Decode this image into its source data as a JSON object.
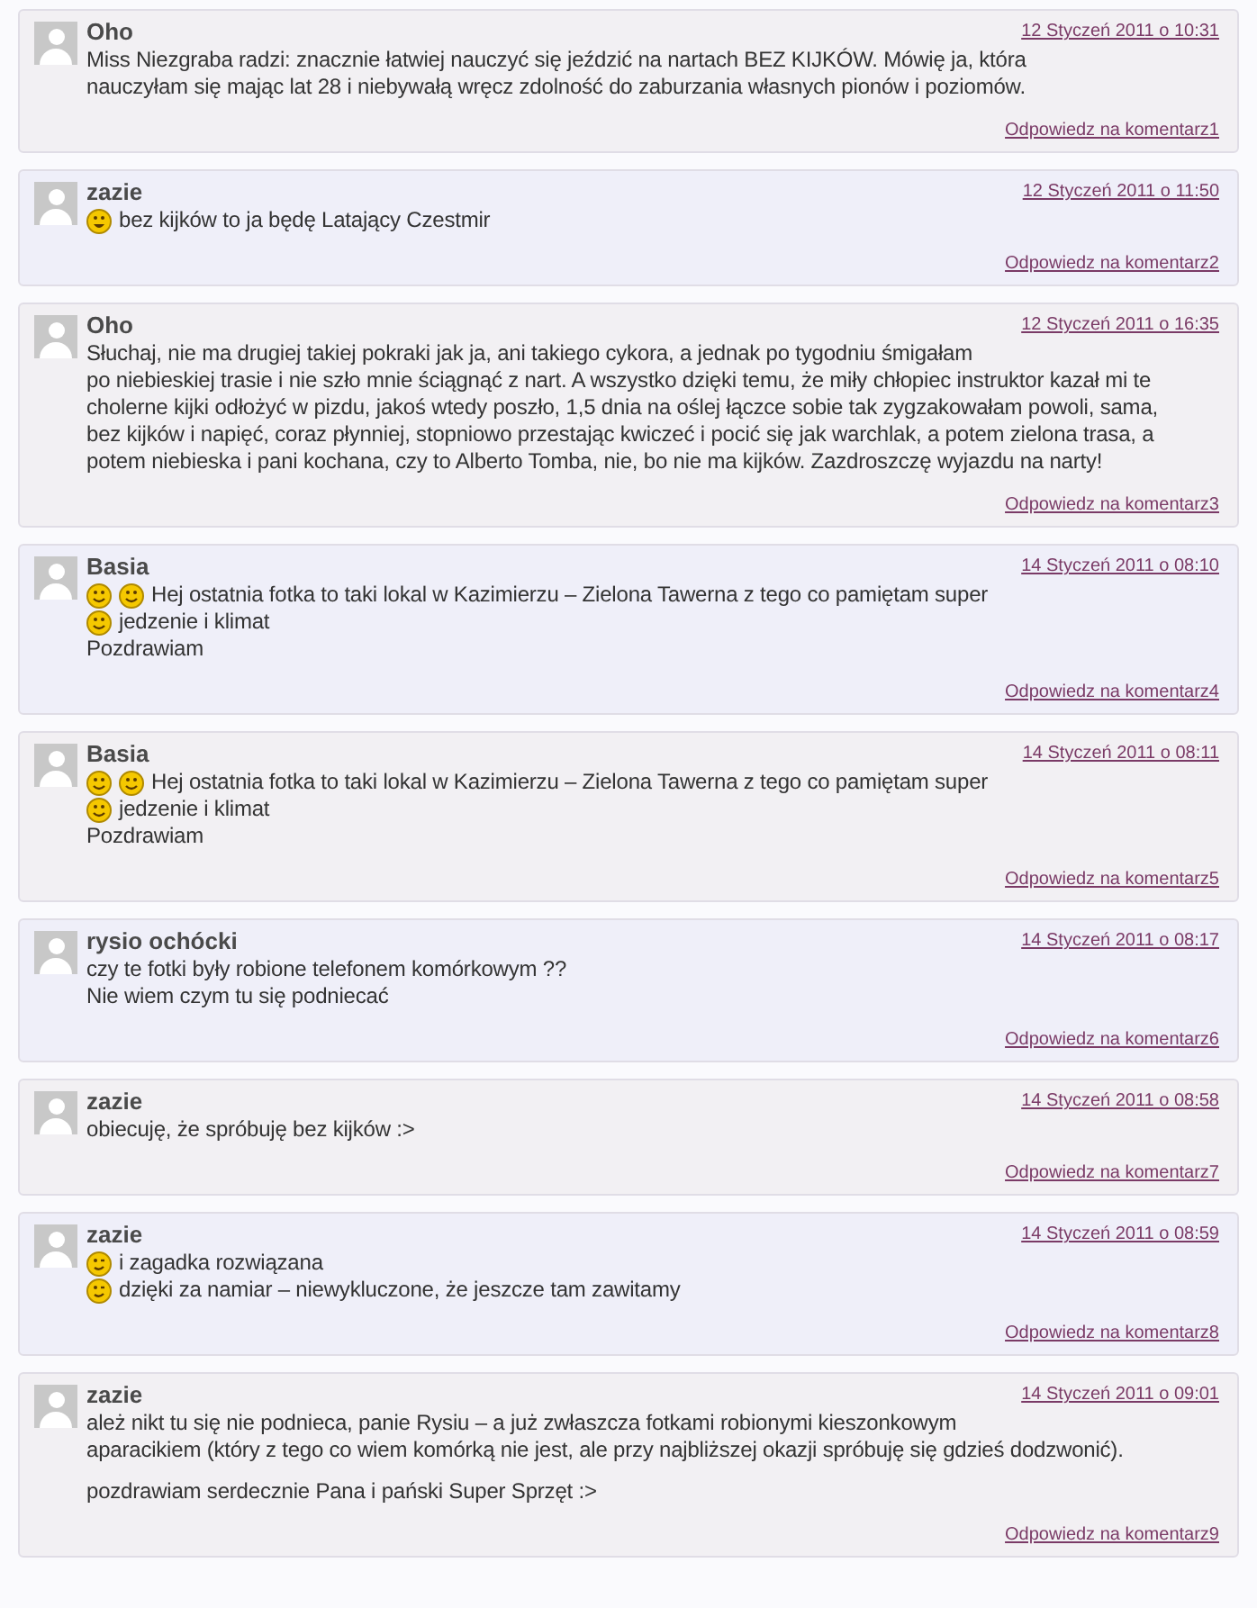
{
  "comments": [
    {
      "author": "Oho",
      "date": "12 Styczeń 2011 o 10:31",
      "reply": "Odpowiedz na komentarz1",
      "paragraphs": [
        [
          {
            "text": "Miss Niezgraba radzi: znacznie łatwiej nauczyć się jeździć na nartach BEZ KIJKÓW. Mówię ja, która"
          },
          {
            "text": "nauczyłam się mając lat 28 i niebywałą wręcz zdolność do zaburzania własnych pionów i poziomów."
          }
        ]
      ]
    },
    {
      "author": "zazie",
      "date": "12 Styczeń 2011 o 11:50",
      "reply": "Odpowiedz na komentarz2",
      "paragraphs": [
        [
          {
            "emoticons": [
              {
                "kind": "grin"
              }
            ],
            "text": "bez kijków to ja będę Latający Czestmir"
          }
        ]
      ]
    },
    {
      "author": "Oho",
      "date": "12 Styczeń 2011 o 16:35",
      "reply": "Odpowiedz na komentarz3",
      "paragraphs": [
        [
          {
            "text": "Słuchaj, nie ma drugiej takiej pokraki jak ja, ani takiego cykora, a jednak po tygodniu śmigałam"
          },
          {
            "text": "po niebieskiej trasie i nie szło mnie ściągnąć z nart. A wszystko dzięki temu, że miły chłopiec instruktor kazał mi te"
          },
          {
            "text": "cholerne kijki odłożyć w pizdu, jakoś wtedy poszło, 1,5 dnia na oślej łączce sobie tak zygzakowałam powoli, sama,"
          },
          {
            "text": "bez kijków i napięć, coraz płynniej, stopniowo przestając kwiczeć i pocić się jak warchlak, a potem zielona trasa, a"
          },
          {
            "text": "potem niebieska i pani kochana, czy to Alberto Tomba, nie, bo nie ma kijków. Zazdroszczę wyjazdu na narty!"
          }
        ]
      ]
    },
    {
      "author": "Basia",
      "date": "14 Styczeń 2011 o 08:10",
      "reply": "Odpowiedz na komentarz4",
      "paragraphs": [
        [
          {
            "emoticons": [
              {
                "kind": "smile"
              },
              {
                "kind": "smile"
              }
            ],
            "text": "Hej ostatnia fotka to taki lokal w Kazimierzu – Zielona Tawerna z tego co pamiętam super"
          },
          {
            "emoticons": [
              {
                "kind": "smile"
              }
            ],
            "text": "jedzenie i klimat"
          },
          {
            "text": "Pozdrawiam"
          }
        ]
      ]
    },
    {
      "author": "Basia",
      "date": "14 Styczeń 2011 o 08:11",
      "reply": "Odpowiedz na komentarz5",
      "paragraphs": [
        [
          {
            "emoticons": [
              {
                "kind": "smile"
              },
              {
                "kind": "smile"
              }
            ],
            "text": "Hej ostatnia fotka to taki lokal w Kazimierzu – Zielona Tawerna z tego co pamiętam super"
          },
          {
            "emoticons": [
              {
                "kind": "smile"
              }
            ],
            "text": "jedzenie i klimat"
          },
          {
            "text": "Pozdrawiam"
          }
        ]
      ]
    },
    {
      "author": "rysio ochócki",
      "date": "14 Styczeń 2011 o 08:17",
      "reply": "Odpowiedz na komentarz6",
      "paragraphs": [
        [
          {
            "text": "czy te fotki były robione telefonem komórkowym ??"
          },
          {
            "text": "Nie wiem czym tu się podniecać"
          }
        ]
      ]
    },
    {
      "author": "zazie",
      "date": "14 Styczeń 2011 o 08:58",
      "reply": "Odpowiedz na komentarz7",
      "paragraphs": [
        [
          {
            "text": "obiecuję, że spróbuję bez kijków :>"
          }
        ]
      ]
    },
    {
      "author": "zazie",
      "date": "14 Styczeń 2011 o 08:59",
      "reply": "Odpowiedz na komentarz8",
      "paragraphs": [
        [
          {
            "emoticons": [
              {
                "kind": "wink"
              }
            ],
            "text": "i zagadka rozwiązana"
          },
          {
            "emoticons": [
              {
                "kind": "wink"
              }
            ],
            "text": "dzięki za namiar – niewykluczone, że jeszcze tam zawitamy"
          }
        ]
      ]
    },
    {
      "author": "zazie",
      "date": "14 Styczeń 2011 o 09:01",
      "reply": "Odpowiedz na komentarz9",
      "paragraphs": [
        [
          {
            "text": "ależ nikt tu się nie podnieca, panie Rysiu – a już zwłaszcza fotkami robionymi kieszonkowym"
          },
          {
            "text": "aparacikiem (który z tego co wiem komórką nie jest, ale przy najbliższej okazji spróbuję się gdzieś dodzwonić)."
          }
        ],
        [
          {
            "text": "pozdrawiam serdecznie Pana i pański Super Sprzęt :>"
          }
        ]
      ]
    }
  ]
}
